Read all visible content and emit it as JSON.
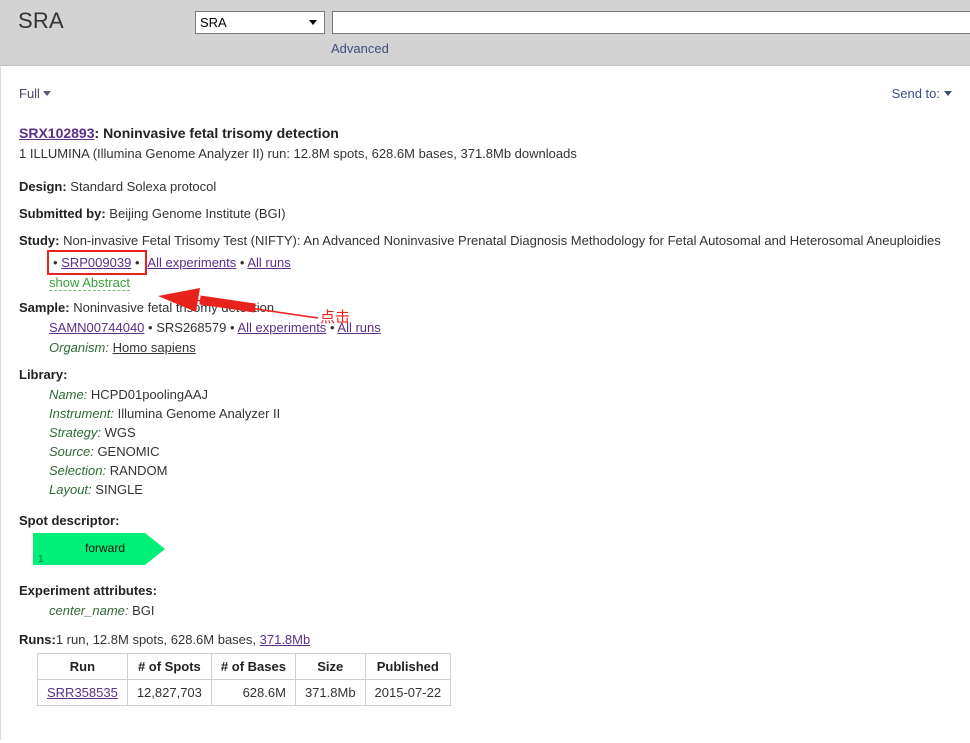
{
  "header": {
    "db_title": "SRA",
    "db_select_value": "SRA",
    "db_select_options": [
      "SRA"
    ],
    "search_value": "",
    "search_placeholder": "",
    "advanced_label": "Advanced"
  },
  "toolbar": {
    "display_format": "Full",
    "send_to": "Send to:"
  },
  "record": {
    "accession": "SRX102893",
    "title_suffix": ": Noninvasive fetal trisomy detection",
    "summary": "1 ILLUMINA (Illumina Genome Analyzer II) run: 12.8M spots, 628.6M bases, 371.8Mb downloads",
    "design_label": "Design:",
    "design_value": "Standard Solexa protocol",
    "submitted_label": "Submitted by:",
    "submitted_value": "Beijing Genome Institute (BGI)",
    "study_label": "Study:",
    "study_value": "Non-invasive Fetal Trisomy Test (NIFTY): An Advanced Noninvasive Prenatal Diagnosis Methodology for Fetal Autosomal and Heterosomal Aneuploidies",
    "study_accession": "SRP009039",
    "study_all_experiments": "All experiments",
    "study_all_runs": "All runs",
    "show_abstract": "show Abstract",
    "sample_label": "Sample:",
    "sample_value": "Noninvasive fetal trisomy detection",
    "sample_biosample": "SAMN00744040",
    "sample_srs": "SRS268579",
    "sample_all_experiments": "All experiments",
    "sample_all_runs": "All runs",
    "organism_label": "Organism:",
    "organism_value": "Homo sapiens",
    "library_label": "Library:",
    "library": [
      {
        "key": "Name:",
        "value": "HCPD01poolingAAJ"
      },
      {
        "key": "Instrument:",
        "value": "Illumina Genome Analyzer II"
      },
      {
        "key": "Strategy:",
        "value": "WGS"
      },
      {
        "key": "Source:",
        "value": "GENOMIC"
      },
      {
        "key": "Selection:",
        "value": "RANDOM"
      },
      {
        "key": "Layout:",
        "value": "SINGLE"
      }
    ],
    "spot_descriptor_label": "Spot descriptor:",
    "spot_read_label": "forward",
    "spot_read_index": "1",
    "spot_color": "#00ef78",
    "experiment_attributes_label": "Experiment attributes:",
    "attr_key": "center_name:",
    "attr_value": "BGI",
    "runs_label": "Runs:",
    "runs_summary": "1 run, 12.8M spots, 628.6M bases, ",
    "runs_size_link": "371.8Mb",
    "bullet": "•"
  },
  "runs_table": {
    "columns": [
      "Run",
      "# of Spots",
      "# of Bases",
      "Size",
      "Published"
    ],
    "rows": [
      {
        "run": "SRR358535",
        "spots": "12,827,703",
        "bases": "628.6M",
        "size": "371.8Mb",
        "published": "2015-07-22"
      }
    ]
  },
  "annotation": {
    "note_text": "点击",
    "highlight_color": "#e8221d"
  }
}
